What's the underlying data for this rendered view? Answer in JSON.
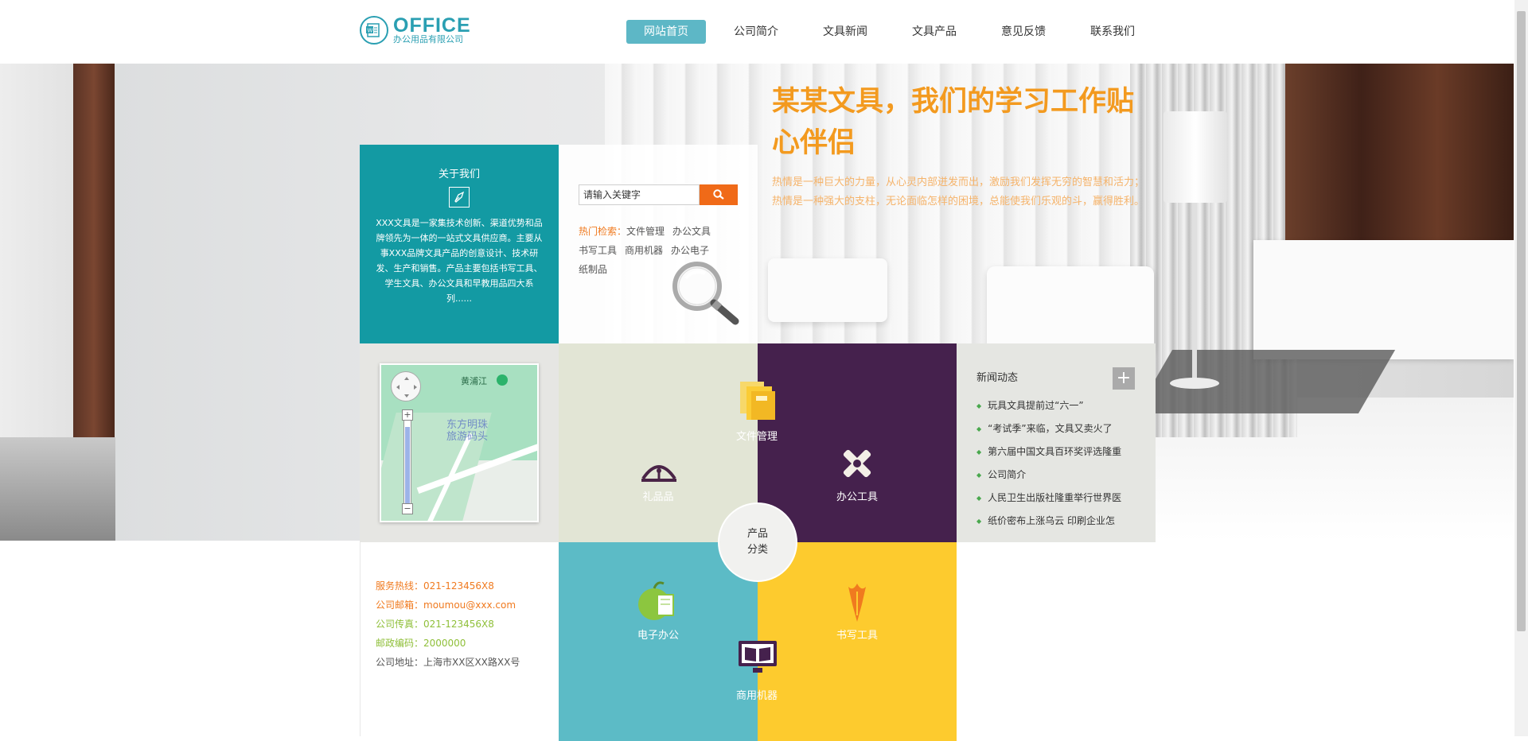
{
  "brand": {
    "logo_main": "OFFICE",
    "logo_sub": "办公用品有限公司"
  },
  "nav": [
    {
      "label": "网站首页",
      "active": true
    },
    {
      "label": "公司简介"
    },
    {
      "label": "文具新闻"
    },
    {
      "label": "文具产品"
    },
    {
      "label": "意见反馈"
    },
    {
      "label": "联系我们"
    }
  ],
  "hero": {
    "title": "某某文具，我们的学习工作贴心伴侣",
    "text_1": "热情是一种巨大的力量，从心灵内部迸发而出，激励我们发挥无穷的智慧和活力；",
    "text_2": "热情是一种强大的支柱，无论面临怎样的困境，总能使我们乐观的斗，赢得胜利。"
  },
  "about": {
    "title": "关于我们",
    "desc": "XXX文具是一家集技术创新、渠道优势和品牌领先为一体的一站式文具供应商。主要从事XXX品牌文具产品的创意设计、技术研发、生产和销售。产品主要包括书写工具、学生文具、办公文具和早教用品四大系列......"
  },
  "search": {
    "placeholder": "请输入关键字",
    "hot_label": "热门检索：",
    "keywords": [
      "文件管理",
      "办公文具",
      "书写工具",
      "商用机器",
      "办公电子",
      "纸制品"
    ]
  },
  "map": {
    "label_1": "黄浦江",
    "label_2": "东方明珠\n旅游码头",
    "zoom_in": "+",
    "zoom_out": "−"
  },
  "products": {
    "center_line_1": "产品",
    "center_line_2": "分类",
    "file": "文件管理",
    "gift": "礼品品",
    "office": "办公工具",
    "ebook": "电子办公",
    "pen": "书写工具",
    "machine": "商用机器"
  },
  "news": {
    "title": "新闻动态",
    "more": "+",
    "items": [
      "玩具文具提前过“六一”",
      "“考试季”来临，文具又卖火了",
      "第六届中国文具百环奖评选隆重",
      "公司简介",
      "人民卫生出版社隆重举行世界医",
      "纸价密布上涨乌云 印刷企业怎"
    ]
  },
  "contact": {
    "hotline": "服务热线：021-123456X8",
    "email": "公司邮箱：moumou@xxx.com",
    "fax": "公司传真：021-123456X8",
    "zip": "邮政编码：2000000",
    "address": "公司地址：上海市XX区XX路XX号"
  },
  "colors": {
    "teal": "#139aa3",
    "orange": "#f39a1f",
    "purple": "#45214d",
    "yellow": "#fdcb2e",
    "light_teal": "#5cbbc6",
    "sage": "#e2e5d5"
  },
  "icons": [
    "word-logo-icon",
    "search-icon",
    "pen-nib-icon",
    "magnifier-icon",
    "folder-icon",
    "gift-icon",
    "tools-icon",
    "apple-book-icon",
    "brush-icon",
    "monitor-book-icon"
  ]
}
